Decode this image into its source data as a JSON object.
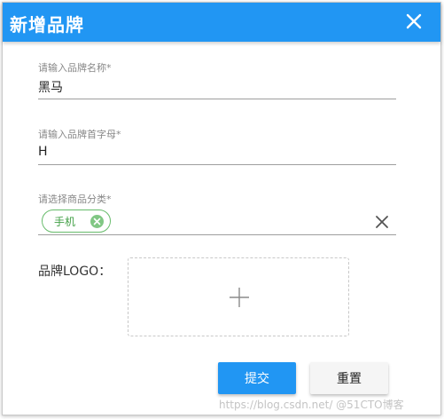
{
  "dialog": {
    "title": "新增品牌",
    "close_icon": "close-icon"
  },
  "form": {
    "brand_name": {
      "label": "请输入品牌名称*",
      "value": "黑马"
    },
    "initial_letter": {
      "label": "请输入品牌首字母*",
      "value": "H"
    },
    "category": {
      "label": "请选择商品分类*",
      "chips": [
        {
          "label": "手机",
          "remove_icon": "chip-close-icon"
        }
      ],
      "clear_icon": "clear-icon"
    },
    "logo": {
      "label": "品牌LOGO：",
      "upload_icon": "plus-icon"
    }
  },
  "actions": {
    "submit_label": "提交",
    "reset_label": "重置"
  },
  "watermark": "https://blog.csdn.net/ @51CTO博客",
  "colors": {
    "primary": "#2196f3",
    "chip_border": "#66bb6a",
    "chip_text": "#43a047"
  }
}
